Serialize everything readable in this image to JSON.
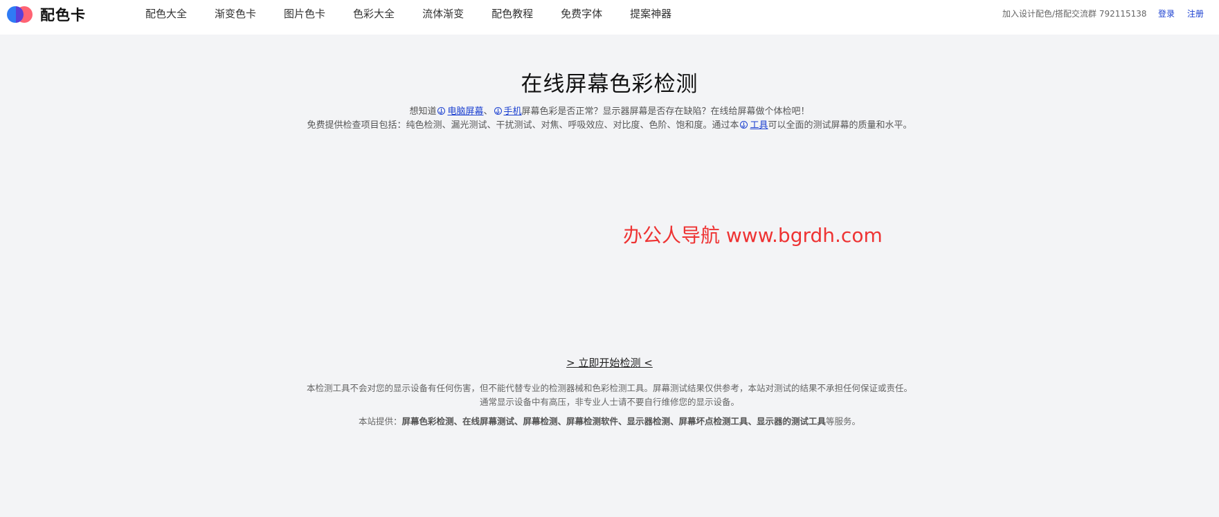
{
  "app": {
    "logo_text": "配色卡"
  },
  "nav": {
    "items": [
      {
        "label": "配色大全"
      },
      {
        "label": "渐变色卡"
      },
      {
        "label": "图片色卡"
      },
      {
        "label": "色彩大全"
      },
      {
        "label": "流体渐变"
      },
      {
        "label": "配色教程"
      },
      {
        "label": "免费字体"
      },
      {
        "label": "提案神器"
      }
    ]
  },
  "header": {
    "group_text": "加入设计配色/搭配交流群 792115138",
    "login": "登录",
    "register": "注册"
  },
  "main": {
    "title": "在线屏幕色彩检测",
    "intro_line1": {
      "prefix": "想知道",
      "link1": "电脑屏幕",
      "sep": "、",
      "link2": "手机",
      "suffix": "屏幕色彩是否正常？显示器屏幕是否存在缺陷？在线给屏幕做个体检吧！"
    },
    "intro_line2": {
      "prefix": "免费提供检查项目包括：纯色检测、漏光测试、干扰测试、对焦、呼吸效应、对比度、色阶、饱和度。通过本",
      "link": "工具",
      "suffix": "可以全面的测试屏幕的质量和水平。"
    },
    "watermark": "办公人导航 www.bgrdh.com",
    "start_button": "> 立即开始检测 <",
    "disclaimer_line1": "本检测工具不会对您的显示设备有任何伤害，但不能代替专业的检测器械和色彩检测工具。屏幕测试结果仅供参考，本站对测试的结果不承担任何保证或责任。",
    "disclaimer_line2": "通常显示设备中有高压，非专业人士请不要自行维修您的显示设备。",
    "services": {
      "prefix": "本站提供：",
      "items": "屏幕色彩检测、在线屏幕测试、屏幕检测、屏幕检测软件、显示器检测、屏幕坏点检测工具、显示器的测试工具",
      "suffix": "等服务。"
    }
  },
  "colors": {
    "background": "#f3f4f6",
    "link": "#1a3fd0",
    "watermark": "#ee3333",
    "logo_blue": "#2f7bf5",
    "logo_red": "#ff5b6b"
  }
}
